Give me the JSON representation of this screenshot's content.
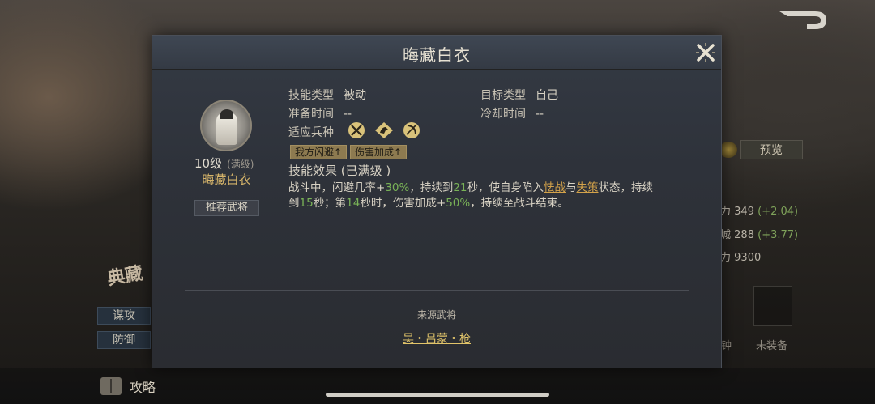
{
  "background": {
    "preview_label": "预览",
    "stats": [
      {
        "label": "力",
        "value": "349",
        "delta": "(+2.04)"
      },
      {
        "label": "城",
        "value": "288",
        "delta": "(+3.77)"
      },
      {
        "label": "力",
        "value": "9300",
        "delta": ""
      }
    ],
    "equip_label_1": "钟",
    "equip_label_2": "未装备",
    "left_tabs": [
      "谋攻",
      "防御"
    ],
    "seal_text": "典藏",
    "guide_label": "攻略"
  },
  "modal": {
    "title": "晦藏白衣",
    "item": {
      "level": "10级",
      "level_note": "(满级)",
      "name": "晦藏白衣",
      "recommend_label": "推荐武将"
    },
    "skill_type_label": "技能类型",
    "skill_type_value": "被动",
    "target_type_label": "目标类型",
    "target_type_value": "自己",
    "prep_time_label": "准备时间",
    "prep_time_value": "--",
    "cooldown_label": "冷却时间",
    "cooldown_value": "--",
    "troop_label": "适应兵种",
    "troop_icons": [
      "infantry-icon",
      "cavalry-icon",
      "archer-icon"
    ],
    "tags": [
      "我方闪避↑",
      "伤害加成↑"
    ],
    "effect_title": "技能效果 (已满级 )",
    "desc": {
      "p1": "战斗中，闪避几率+",
      "v1": "30%",
      "p2": "，持续到",
      "v2": "21",
      "p3": "秒，使自身陷入",
      "s1": "怯战",
      "p4": "与",
      "s2": "失策",
      "p5": "状态，持续到",
      "v3": "15",
      "p6": "秒；第",
      "v4": "14",
      "p7": "秒时，伤害加成+",
      "v5": "50%",
      "p8": "，持续至战斗结束。"
    },
    "source_label": "来源武将",
    "source_link": "吴・吕蒙・枪"
  },
  "colors": {
    "accent_gold": "#d5b46a",
    "highlight_green": "#79b257",
    "status_orange": "#d3a24a"
  }
}
